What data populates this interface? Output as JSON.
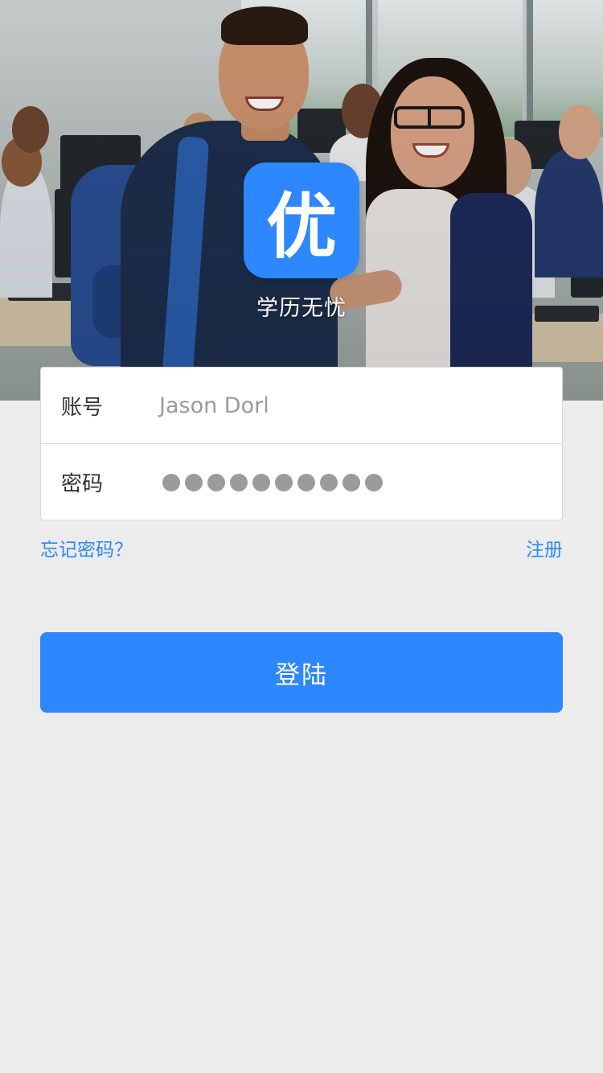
{
  "colors": {
    "accent": "#2d87ff",
    "background": "#ececec",
    "card": "#ffffff",
    "placeholder_text": "#9b9b9b"
  },
  "hero": {
    "image": "students-in-classroom-photo"
  },
  "logo": {
    "glyph": "优",
    "icon": "app-logo-icon"
  },
  "app_name": "学历无忧",
  "login_form": {
    "account_label": "账号",
    "account_value": "Jason Dorl",
    "password_label": "密码",
    "password_mask_count": 10
  },
  "links": {
    "forgot_password": "忘记密码？",
    "register": "注册"
  },
  "login_button_label": "登陆"
}
